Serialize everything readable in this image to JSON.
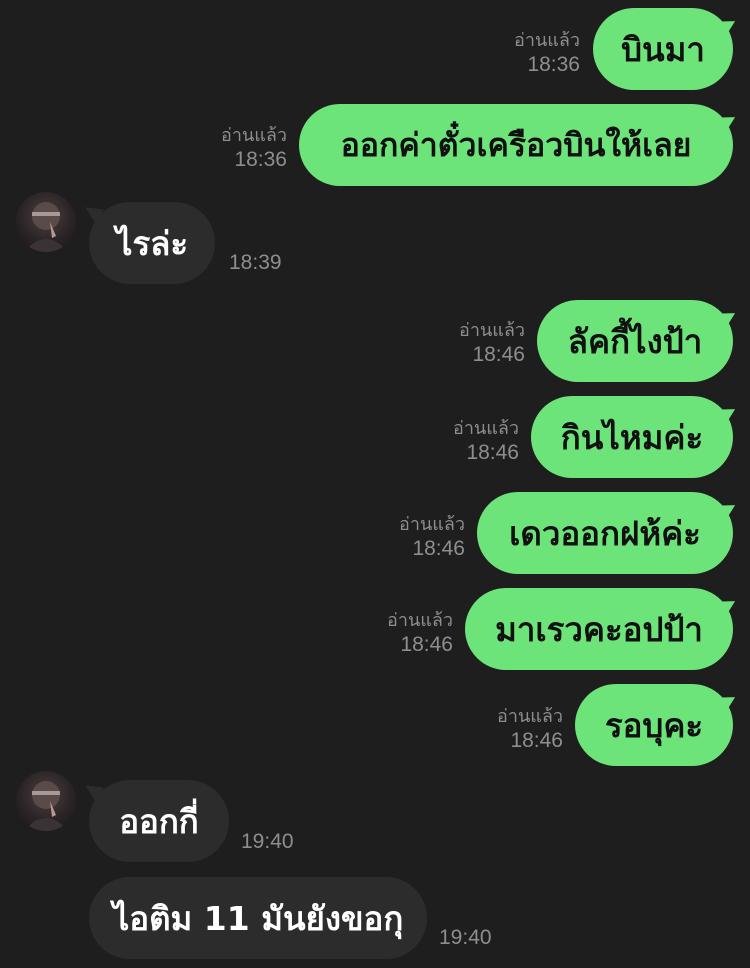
{
  "read_label": "อ่านแล้ว",
  "messages": [
    {
      "text": "บินมา",
      "time": "18:36"
    },
    {
      "text": "ออกค่าตั๋วเครือวบินให้เลย",
      "time": "18:36"
    },
    {
      "text": "ไรล่ะ",
      "time": "18:39"
    },
    {
      "text": "ลัคกี้ไงป้า",
      "time": "18:46"
    },
    {
      "text": "กินไหมค่ะ",
      "time": "18:46"
    },
    {
      "text": "เดวออกฝห้ค่ะ",
      "time": "18:46"
    },
    {
      "text": "มาเรวคะอปป้า",
      "time": "18:46"
    },
    {
      "text": "รอบุคะ",
      "time": "18:46"
    },
    {
      "text": "ออกกี่",
      "time": "19:40"
    },
    {
      "text": "ไอติม 11 มันยังขอกุ",
      "time": "19:40"
    }
  ],
  "colors": {
    "background": "#1e1e1e",
    "outgoing_bubble": "#6de47a",
    "incoming_bubble": "#2c2c2c",
    "meta_text": "#8e8e8e"
  },
  "icons": {
    "avatar": "contact-avatar-photo"
  }
}
